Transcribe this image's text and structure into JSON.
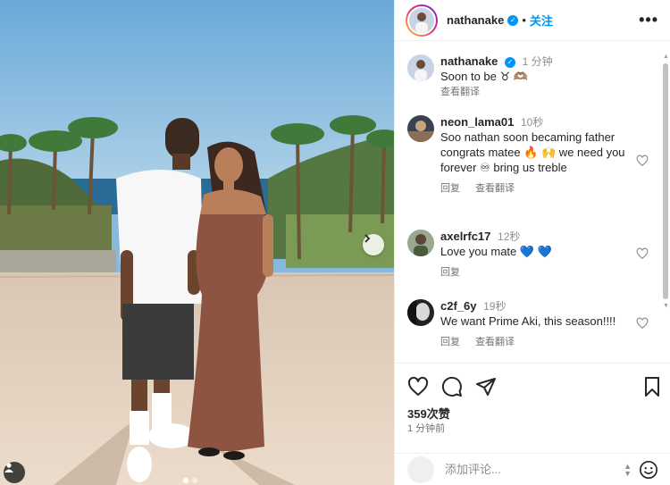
{
  "post": {
    "author": "nathanake",
    "follow_label": "关注",
    "more_label": "•••",
    "carousel": {
      "current": 1,
      "total": 2
    }
  },
  "caption": {
    "username": "nathanake",
    "time": "1 分钟",
    "text": "Soon to be",
    "emoji": "♉ 🫶🏽",
    "translate": "查看翻译"
  },
  "comments": [
    {
      "username": "neon_lama01",
      "time": "10秒",
      "text": "Soo nathan soon becaming father congrats matee 🔥 🙌 we need you forever ♾ bring us treble",
      "reply": "回复",
      "translate": "查看翻译"
    },
    {
      "username": "axelrfc17",
      "time": "12秒",
      "text": "Love you mate 💙 💙",
      "reply": "回复",
      "translate": ""
    },
    {
      "username": "c2f_6y",
      "time": "19秒",
      "text": "We want Prime Aki, this season!!!!",
      "reply": "回复",
      "translate": "查看翻译"
    }
  ],
  "stats": {
    "likes": "359次赞",
    "posted": "1 分钟前"
  },
  "composer": {
    "placeholder": "添加评论..."
  },
  "icons": [
    "heart-icon",
    "comment-icon",
    "share-icon",
    "bookmark-icon",
    "more-icon",
    "chevron-right-icon",
    "tag-user-icon",
    "emoji-icon",
    "verified-icon"
  ],
  "colors": {
    "accent": "#0095f6",
    "text": "#262626",
    "muted": "#737373",
    "border": "#efefef"
  }
}
